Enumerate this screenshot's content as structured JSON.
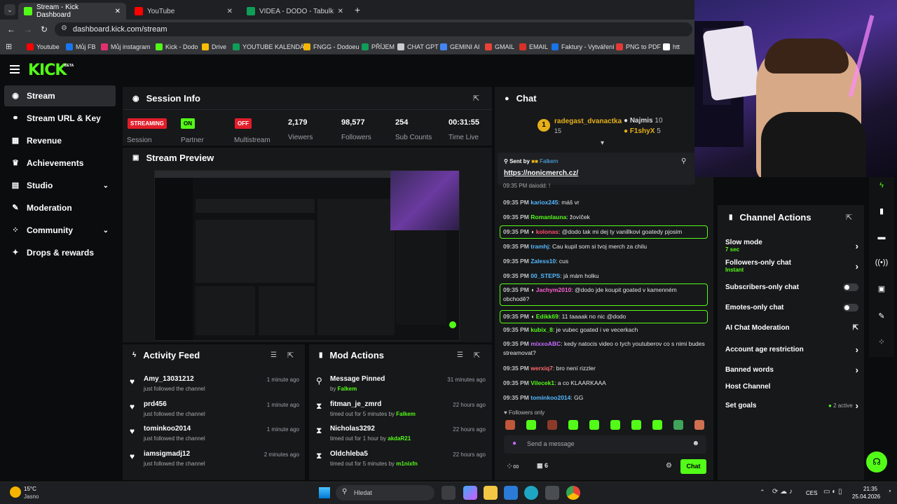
{
  "browser": {
    "tabs": [
      {
        "title": "Stream - Kick Dashboard",
        "color": "#53fc18"
      },
      {
        "title": "YouTube",
        "color": "#ff0000"
      },
      {
        "title": "VIDEA - DODO - Tabulky Googl",
        "color": "#0f9d58"
      }
    ],
    "new_tab": "+",
    "url": "dashboard.kick.com/stream",
    "bookmarks": [
      {
        "label": "Youtube",
        "color": "#ff0000"
      },
      {
        "label": "Můj FB",
        "color": "#1877f2"
      },
      {
        "label": "Můj instagram",
        "color": "#e1306c"
      },
      {
        "label": "Kick - Dodo",
        "color": "#53fc18"
      },
      {
        "label": "Drive",
        "color": "#fbbc04"
      },
      {
        "label": "YOUTUBE KALENDÁŘ",
        "color": "#0f9d58"
      },
      {
        "label": "FNGG - Dodoeu",
        "color": "#f4b400"
      },
      {
        "label": "PŘÍJEM",
        "color": "#0f9d58"
      },
      {
        "label": "CHAT GPT",
        "color": "#cccccc"
      },
      {
        "label": "GEMINI AI",
        "color": "#4285f4"
      },
      {
        "label": "GMAIL",
        "color": "#ea4335"
      },
      {
        "label": "EMAIL",
        "color": "#d93025"
      },
      {
        "label": "Faktury - Vytváření",
        "color": "#1a73e8"
      },
      {
        "label": "PNG to PDF",
        "color": "#e53935"
      },
      {
        "label": "htt",
        "color": "#ffffff"
      }
    ]
  },
  "brand": {
    "logo": "KICK",
    "beta": "BETA",
    "accent": "#53fc18"
  },
  "sidebar": {
    "items": [
      {
        "label": "Stream",
        "icon": "broadcast-icon"
      },
      {
        "label": "Stream URL & Key",
        "icon": "link-icon"
      },
      {
        "label": "Revenue",
        "icon": "revenue-icon"
      },
      {
        "label": "Achievements",
        "icon": "trophy-icon"
      },
      {
        "label": "Studio",
        "icon": "studio-icon"
      },
      {
        "label": "Moderation",
        "icon": "wrench-icon"
      },
      {
        "label": "Community",
        "icon": "community-icon"
      },
      {
        "label": "Drops & rewards",
        "icon": "gift-icon"
      }
    ]
  },
  "session": {
    "title": "Session Info",
    "session_label": "Session",
    "streaming": "STREAMING",
    "partner_label": "Partner",
    "partner_value": "ON",
    "multistream_label": "Multistream",
    "multistream_value": "OFF",
    "stats": [
      {
        "value": "2,179",
        "label": "Viewers"
      },
      {
        "value": "98,577",
        "label": "Followers"
      },
      {
        "value": "254",
        "label": "Sub Counts"
      },
      {
        "value": "00:31:55",
        "label": "Time Live"
      }
    ]
  },
  "preview": {
    "title": "Stream Preview"
  },
  "activity": {
    "title": "Activity Feed",
    "items": [
      {
        "name": "Amy_13031212",
        "action": "just followed the channel",
        "time": "1 minute ago"
      },
      {
        "name": "prd456",
        "action": "just followed the channel",
        "time": "1 minute ago"
      },
      {
        "name": "tominkoo2014",
        "action": "just followed the channel",
        "time": "1 minute ago"
      },
      {
        "name": "iamsigmadj12",
        "action": "just followed the channel",
        "time": "2 minutes ago"
      }
    ]
  },
  "mod": {
    "title": "Mod Actions",
    "items": [
      {
        "title": "Message Pinned",
        "pre": "by ",
        "who": "Falkem",
        "time": "31 minutes ago",
        "icon": "pin-icon"
      },
      {
        "title": "fitman_je_zmrd",
        "pre": "timed out for 5 minutes by ",
        "who": "Falkem",
        "time": "22 hours ago",
        "icon": "hourglass-icon"
      },
      {
        "title": "Nicholas3292",
        "pre": "timed out for 1 hour by ",
        "who": "akdaR21",
        "time": "22 hours ago",
        "icon": "hourglass-icon"
      },
      {
        "title": "Oldchleba5",
        "pre": "timed out for 5 minutes by ",
        "who": "m1nixfn",
        "time": "22 hours ago",
        "icon": "hourglass-icon"
      }
    ]
  },
  "chat": {
    "title": "Chat",
    "top_gifter": {
      "rank": "1",
      "name": "radegast_dvanactka",
      "count": "15"
    },
    "gifters": [
      {
        "name": "Najmis",
        "count": "10"
      },
      {
        "name": "F1shyX",
        "count": "5"
      }
    ],
    "pinned": {
      "sent_by": "Sent by",
      "by": "Falkem",
      "link": "https://nonicmerch.cz/"
    },
    "partial_top": "daiodd: !",
    "messages": [
      {
        "time": "09:35 PM",
        "user": "kariox245",
        "color": "#53b8ff",
        "text": "máš vr",
        "hl": false
      },
      {
        "time": "09:35 PM",
        "user": "Romanlauna",
        "color": "#53fc18",
        "text": "žovíček",
        "hl": false
      },
      {
        "time": "09:35 PM",
        "user": "kolonas",
        "color": "#ff4d6d",
        "text": "@dodo tak mi dej ty vanillkovi goatedy pjosim",
        "hl": true
      },
      {
        "time": "09:35 PM",
        "user": "tramhj",
        "color": "#53b8ff",
        "text": "Cau kupil som si tvoj merch za chilu",
        "hl": false
      },
      {
        "time": "09:35 PM",
        "user": "Zaless10",
        "color": "#53b8ff",
        "text": "cus",
        "hl": false
      },
      {
        "time": "09:35 PM",
        "user": "00_STEPS",
        "color": "#53b8ff",
        "text": "já mám holku",
        "hl": false
      },
      {
        "time": "09:35 PM",
        "user": "Jachym2010",
        "color": "#ff5fd2",
        "text": "@dodo jde koupit goated v kamenném obchodě?",
        "hl": true
      },
      {
        "time": "09:35 PM",
        "user": "Edikk69",
        "color": "#53fc18",
        "text": "11 taaaak no nic @dodo",
        "hl": true
      },
      {
        "time": "09:35 PM",
        "user": "kubix_8",
        "color": "#53fc18",
        "text": "je vubec goated i ve vecerkach",
        "hl": false
      },
      {
        "time": "09:35 PM",
        "user": "mixxoABC",
        "color": "#c56bff",
        "text": "kedy natocis video o tych youtuberov co s nimi budes streamovat?",
        "hl": false
      },
      {
        "time": "09:35 PM",
        "user": "werxiq7",
        "color": "#ff6b6b",
        "text": "bro není rizzler",
        "hl": false
      },
      {
        "time": "09:35 PM",
        "user": "Vilecek1",
        "color": "#53fc18",
        "text": "a co KLAARKAAA",
        "hl": false
      },
      {
        "time": "09:35 PM",
        "user": "tominkoo2014",
        "color": "#53b8ff",
        "text": "GG",
        "hl": false
      }
    ],
    "followers_only": "Followers only",
    "placeholder": "Send a message",
    "count": "6",
    "send": "Chat"
  },
  "channel_actions": {
    "title": "Channel Actions",
    "rows": [
      {
        "label": "Slow mode",
        "sub": "7 sec",
        "ctrl": "chevron"
      },
      {
        "label": "Followers-only chat",
        "sub": "Instant",
        "ctrl": "chevron"
      },
      {
        "label": "Subscribers-only chat",
        "sub": "",
        "ctrl": "toggle"
      },
      {
        "label": "Emotes-only chat",
        "sub": "",
        "ctrl": "toggle"
      },
      {
        "label": "AI Chat Moderation",
        "sub": "",
        "ctrl": "external"
      },
      {
        "label": "Account age restriction",
        "sub": "",
        "ctrl": "chevron"
      },
      {
        "label": "Banned words",
        "sub": "",
        "ctrl": "chevron"
      },
      {
        "label": "Host Channel",
        "sub": "",
        "ctrl": "none"
      },
      {
        "label": "Set goals",
        "sub": "",
        "ctrl": "chevron"
      }
    ],
    "goals_active": "2 active"
  },
  "taskbar": {
    "temp": "15°C",
    "weather": "Jasno",
    "search": "Hledat",
    "lang": "CES",
    "time": "21:35",
    "date": "25.04.2026"
  }
}
